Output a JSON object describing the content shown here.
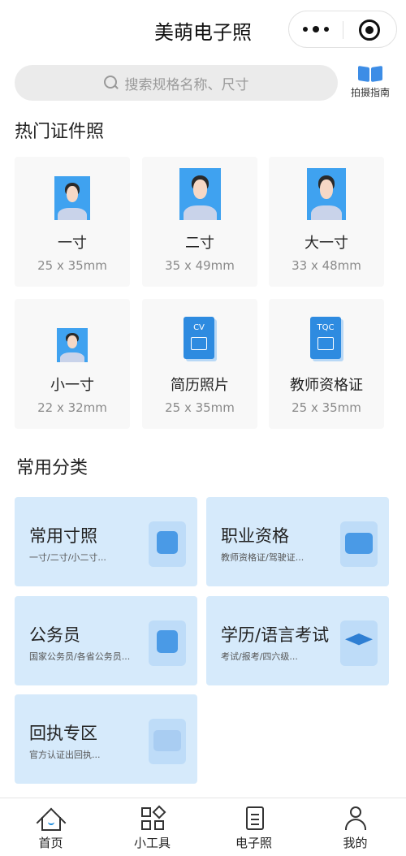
{
  "header": {
    "title": "美萌电子照"
  },
  "search": {
    "placeholder": "搜索规格名称、尺寸",
    "guide_label": "拍摄指南"
  },
  "hot": {
    "title": "热门证件照",
    "items": [
      {
        "name": "一寸",
        "size": "25 x 35mm",
        "icon": "portrait"
      },
      {
        "name": "二寸",
        "size": "35 x 49mm",
        "icon": "portrait"
      },
      {
        "name": "大一寸",
        "size": "33 x 48mm",
        "icon": "portrait"
      },
      {
        "name": "小一寸",
        "size": "22 x 32mm",
        "icon": "portrait"
      },
      {
        "name": "简历照片",
        "size": "25 x 35mm",
        "icon": "cv-document",
        "tag": "CV"
      },
      {
        "name": "教师资格证",
        "size": "25 x 35mm",
        "icon": "tqc-document",
        "tag": "TQC"
      }
    ]
  },
  "categories": {
    "title": "常用分类",
    "items": [
      {
        "name": "常用寸照",
        "sub": "一寸/二寸/小二寸...",
        "icon": "user-portrait-icon"
      },
      {
        "name": "职业资格",
        "sub": "教师资格证/驾驶证...",
        "icon": "id-card-icon"
      },
      {
        "name": "公务员",
        "sub": "国家公务员/各省公务员...",
        "icon": "official-icon"
      },
      {
        "name": "学历/语言考试",
        "sub": "考试/报考/四六级...",
        "icon": "graduation-cap-icon"
      },
      {
        "name": "回执专区",
        "sub": "官方认证出回执...",
        "icon": "receipt-card-icon"
      }
    ]
  },
  "tabbar": {
    "items": [
      {
        "label": "首页",
        "icon": "home-icon"
      },
      {
        "label": "小工具",
        "icon": "tools-grid-icon"
      },
      {
        "label": "电子照",
        "icon": "document-icon"
      },
      {
        "label": "我的",
        "icon": "user-icon"
      }
    ]
  },
  "colors": {
    "accent": "#3d8de6",
    "card_blue": "#d6eafb",
    "photo_bg": "#3fa2f0"
  }
}
